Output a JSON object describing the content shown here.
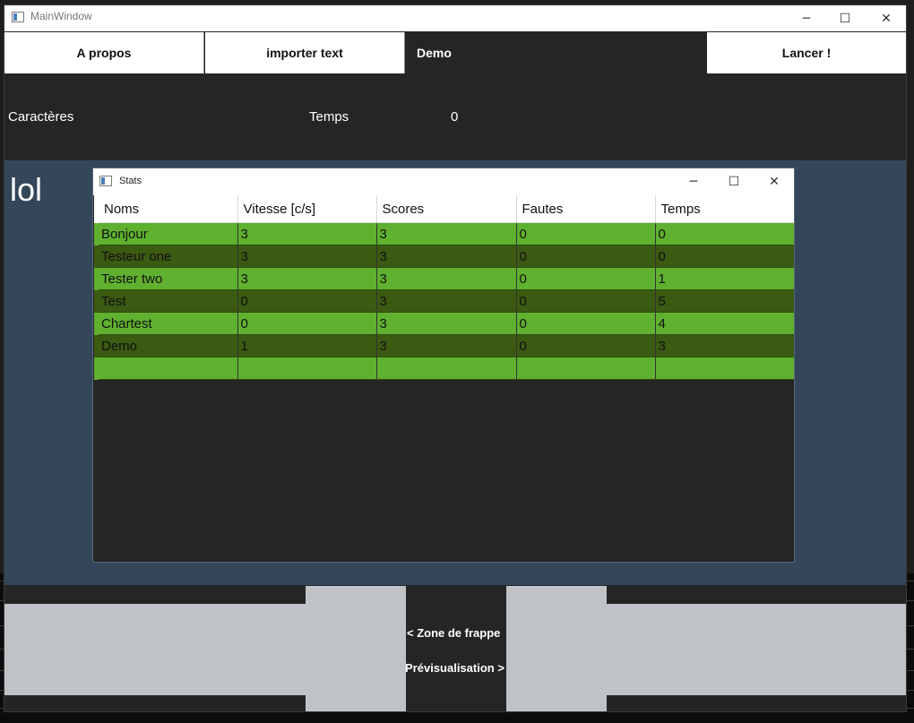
{
  "main_window": {
    "title": "MainWindow",
    "controls": {
      "minimize": "─",
      "maximize": "☐",
      "close": "✕"
    }
  },
  "nav": {
    "about": "A propos",
    "import": "importer text",
    "demo": "Demo",
    "launch": "Lancer !"
  },
  "stats_row": {
    "characters_label": "Caractères",
    "time_label": "Temps",
    "time_value": "0"
  },
  "content": {
    "text": "lol"
  },
  "bottom": {
    "typing_zone": "< Zone de frappe",
    "preview": "Prévisualisation >"
  },
  "stats_window": {
    "title": "Stats",
    "columns": [
      "Noms",
      "Vitesse [c/s]",
      "Scores",
      "Fautes",
      "Temps"
    ],
    "rows": [
      [
        "Bonjour",
        "3",
        "3",
        "0",
        "0"
      ],
      [
        "Testeur one",
        "3",
        "3",
        "0",
        "0"
      ],
      [
        "Tester two",
        "3",
        "3",
        "0",
        "1"
      ],
      [
        "Test",
        "0",
        "3",
        "0",
        "5"
      ],
      [
        "Chartest",
        "0",
        "3",
        "0",
        "4"
      ],
      [
        "Demo",
        "1",
        "3",
        "0",
        "3"
      ],
      [
        "",
        "",
        "",
        "",
        ""
      ]
    ]
  },
  "colors": {
    "row_light": "#5fb12f",
    "row_dark": "#3b5a12",
    "content_bg": "#344659",
    "window_bg": "#252526"
  }
}
